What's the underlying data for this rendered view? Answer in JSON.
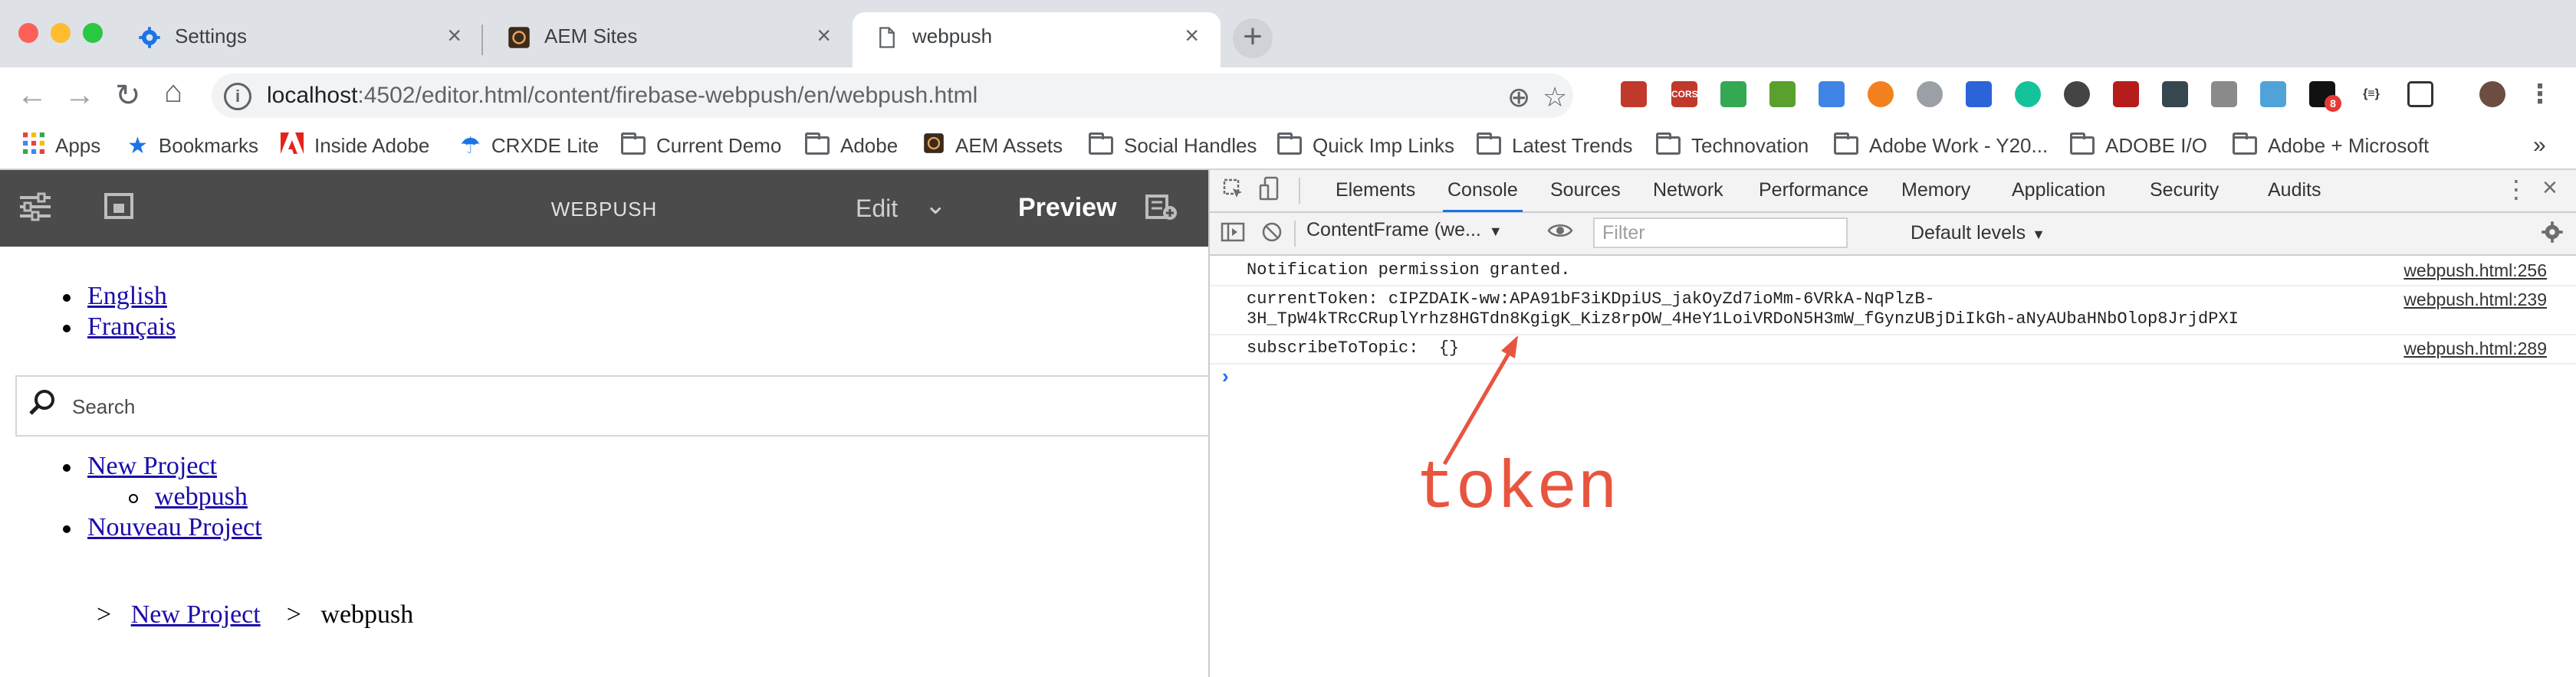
{
  "browser": {
    "tabs": [
      {
        "title": "Settings",
        "icon": "gear-icon",
        "active": false
      },
      {
        "title": "AEM Sites",
        "icon": "aem-icon",
        "active": false
      },
      {
        "title": "webpush",
        "icon": "document-icon",
        "active": true
      }
    ],
    "url": {
      "host": "localhost",
      "rest": ":4502/editor.html/content/firebase-webpush/en/webpush.html"
    },
    "extensions": [
      "ext-red-book",
      "ext-cors",
      "ext-drive",
      "ext-chart",
      "ext-pencil",
      "ext-orange",
      "ext-react",
      "ext-i",
      "ext-grammarly",
      "ext-chatgpt",
      "ext-red-square",
      "ext-hex",
      "ext-grey",
      "ext-save",
      "ext-amazon",
      "ext-json",
      "ext-screenshot",
      "ext-avatar"
    ],
    "extension_labels": {
      "cors": "CORS",
      "amazon_badge": "8",
      "json": "{≡}"
    },
    "bookmarks": [
      {
        "label": "Apps",
        "icon": "apps-grid-icon"
      },
      {
        "label": "Bookmarks",
        "icon": "star-icon"
      },
      {
        "label": "Inside Adobe",
        "icon": "adobe-icon"
      },
      {
        "label": "CRXDE Lite",
        "icon": "crxde-icon"
      },
      {
        "label": "Current Demo",
        "icon": "folder-icon"
      },
      {
        "label": "Adobe",
        "icon": "folder-icon"
      },
      {
        "label": "AEM Assets",
        "icon": "aem-icon"
      },
      {
        "label": "Social Handles",
        "icon": "folder-icon"
      },
      {
        "label": "Quick Imp Links",
        "icon": "folder-icon"
      },
      {
        "label": "Latest Trends",
        "icon": "folder-icon"
      },
      {
        "label": "Technovation",
        "icon": "folder-icon"
      },
      {
        "label": "Adobe Work - Y20...",
        "icon": "folder-icon"
      },
      {
        "label": "ADOBE I/O",
        "icon": "folder-icon"
      },
      {
        "label": "Adobe + Microsoft",
        "icon": "folder-icon"
      }
    ],
    "bookmarks_overflow": "»"
  },
  "aem": {
    "title": "WEBPUSH",
    "edit_label": "Edit",
    "preview_label": "Preview",
    "lang_links": [
      "English",
      "Français"
    ],
    "search_placeholder": "Search",
    "nav": {
      "project": "New Project",
      "child": "webpush",
      "other": "Nouveau Project"
    },
    "breadcrumb": {
      "sep": ">",
      "link": "New Project",
      "current": "webpush"
    }
  },
  "devtools": {
    "tabs": [
      "Elements",
      "Console",
      "Sources",
      "Network",
      "Performance",
      "Memory",
      "Application",
      "Security",
      "Audits"
    ],
    "active_tab": "Console",
    "context": "ContentFrame (we...",
    "filter_placeholder": "Filter",
    "levels": "Default levels",
    "logs": [
      {
        "message": "Notification permission granted.",
        "source": "webpush.html:256"
      },
      {
        "message": "currentToken: cIPZDAIK-ww:APA91bF3iKDpiUS_jakOyZd7ioMm-6VRkA-NqPlzB-",
        "message2": "3H_TpW4kTRcCRuplYrhz8HGTdn8KgigK_Kiz8rpOW_4HeY1LoiVRDoN5H3mW_fGynzUBjDiIkGh-aNyAUbaHNbOlop8JrjdPXI",
        "source": "webpush.html:239"
      },
      {
        "message": "subscribeToTopic:  {}",
        "source": "webpush.html:289"
      }
    ],
    "prompt": "›"
  },
  "annotation": {
    "label": "token",
    "color": "#e8553f"
  }
}
